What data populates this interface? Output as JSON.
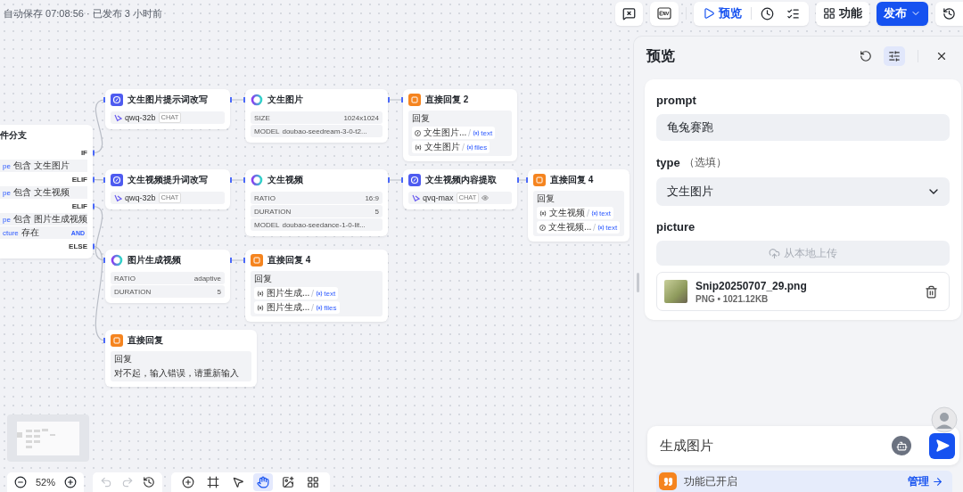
{
  "header": {
    "save_status": "自动保存 07:08:56 · 已发布 3 小时前"
  },
  "toolbar": {
    "preview": "预览",
    "features": "功能",
    "publish": "发布"
  },
  "canvas": {
    "nodes": [
      {
        "kind": "condition",
        "title": "件分支",
        "branches": [
          {
            "label": "IF",
            "conditions": [
              {
                "variable": "pe",
                "operator": "包含",
                "value": "文生图片"
              }
            ]
          },
          {
            "label": "ELIF",
            "conditions": [
              {
                "variable": "pe",
                "operator": "包含",
                "value": "文生视频"
              }
            ]
          },
          {
            "label": "ELIF",
            "logic": "AND",
            "conditions": [
              {
                "variable": "pe",
                "operator": "包含",
                "value": "图片生成视频"
              },
              {
                "variable": "cture",
                "operator": "存在"
              }
            ]
          },
          {
            "label": "ELSE"
          }
        ]
      },
      {
        "kind": "llm",
        "title": "文生图片提示词改写",
        "model": "qwq-32b",
        "tag": "CHAT",
        "vision": false
      },
      {
        "kind": "media",
        "title": "文生图片",
        "params": [
          {
            "kind": "pair",
            "name": "SIZE",
            "value": "1024x1024"
          },
          {
            "kind": "inline",
            "name": "MODEL",
            "value": "doubao-seedream-3-0-t2..."
          }
        ]
      },
      {
        "kind": "reply",
        "title": "直接回复 2",
        "label": "回复",
        "outputs": [
          {
            "kind": "llm",
            "source": "文生图片...",
            "field": "text"
          },
          {
            "kind": "variable",
            "source": "文生图片",
            "field": "files"
          }
        ]
      },
      {
        "kind": "llm",
        "title": "文生视频提升词改写",
        "model": "qwq-32b",
        "tag": "CHAT",
        "vision": false
      },
      {
        "kind": "media",
        "title": "文生视频",
        "params": [
          {
            "kind": "pair",
            "name": "RATIO",
            "value": "16:9"
          },
          {
            "kind": "pair",
            "name": "DURATION",
            "value": "5"
          },
          {
            "kind": "inline",
            "name": "MODEL",
            "value": "doubao-seedance-1-0-lit..."
          }
        ]
      },
      {
        "kind": "llm",
        "title": "文生视频内容提取",
        "model": "qvq-max",
        "tag": "CHAT",
        "vision": true
      },
      {
        "kind": "reply",
        "title": "直接回复 4",
        "label": "回复",
        "outputs": [
          {
            "kind": "variable",
            "source": "文生视频",
            "field": "text"
          },
          {
            "kind": "llm",
            "source": "文生视频...",
            "field": "text"
          }
        ]
      },
      {
        "kind": "media",
        "title": "图片生成视频",
        "params": [
          {
            "kind": "pair",
            "name": "RATIO",
            "value": "adaptive"
          },
          {
            "kind": "pair",
            "name": "DURATION",
            "value": "5"
          }
        ]
      },
      {
        "kind": "reply",
        "title": "直接回复 4",
        "label": "回复",
        "outputs": [
          {
            "kind": "variable",
            "source": "图片生成...",
            "field": "text"
          },
          {
            "kind": "variable",
            "source": "图片生成...",
            "field": "files"
          }
        ]
      },
      {
        "kind": "reply",
        "title": "直接回复",
        "label": "回复",
        "message": "对不起，输入错误，请重新输入"
      }
    ],
    "zoom": "52%",
    "history": [
      {
        "kind": "undo",
        "disabled": true
      },
      {
        "kind": "redo",
        "disabled": true
      },
      {
        "kind": "history",
        "disabled": false
      }
    ],
    "tools": [
      {
        "kind": "add",
        "selected": false
      },
      {
        "kind": "frame",
        "selected": false
      },
      {
        "kind": "pointer",
        "selected": false
      },
      {
        "kind": "hand",
        "selected": true
      },
      {
        "kind": "image",
        "selected": false
      },
      {
        "kind": "plugin",
        "selected": false
      }
    ]
  },
  "preview_panel": {
    "title": "预览",
    "fields": [
      {
        "kind": "text",
        "label": "prompt",
        "value": "龟兔赛跑"
      },
      {
        "kind": "select",
        "label": "type",
        "hint": "（选填）",
        "value": "文生图片"
      },
      {
        "kind": "file",
        "label": "picture",
        "upload": "从本地上传",
        "file_name": "Snip20250707_29.png",
        "file_info": "PNG • 1021.12KB"
      }
    ],
    "chat": {
      "value": "生成图片"
    },
    "feature_bar": {
      "status": "功能已开启",
      "link": "管理"
    }
  }
}
